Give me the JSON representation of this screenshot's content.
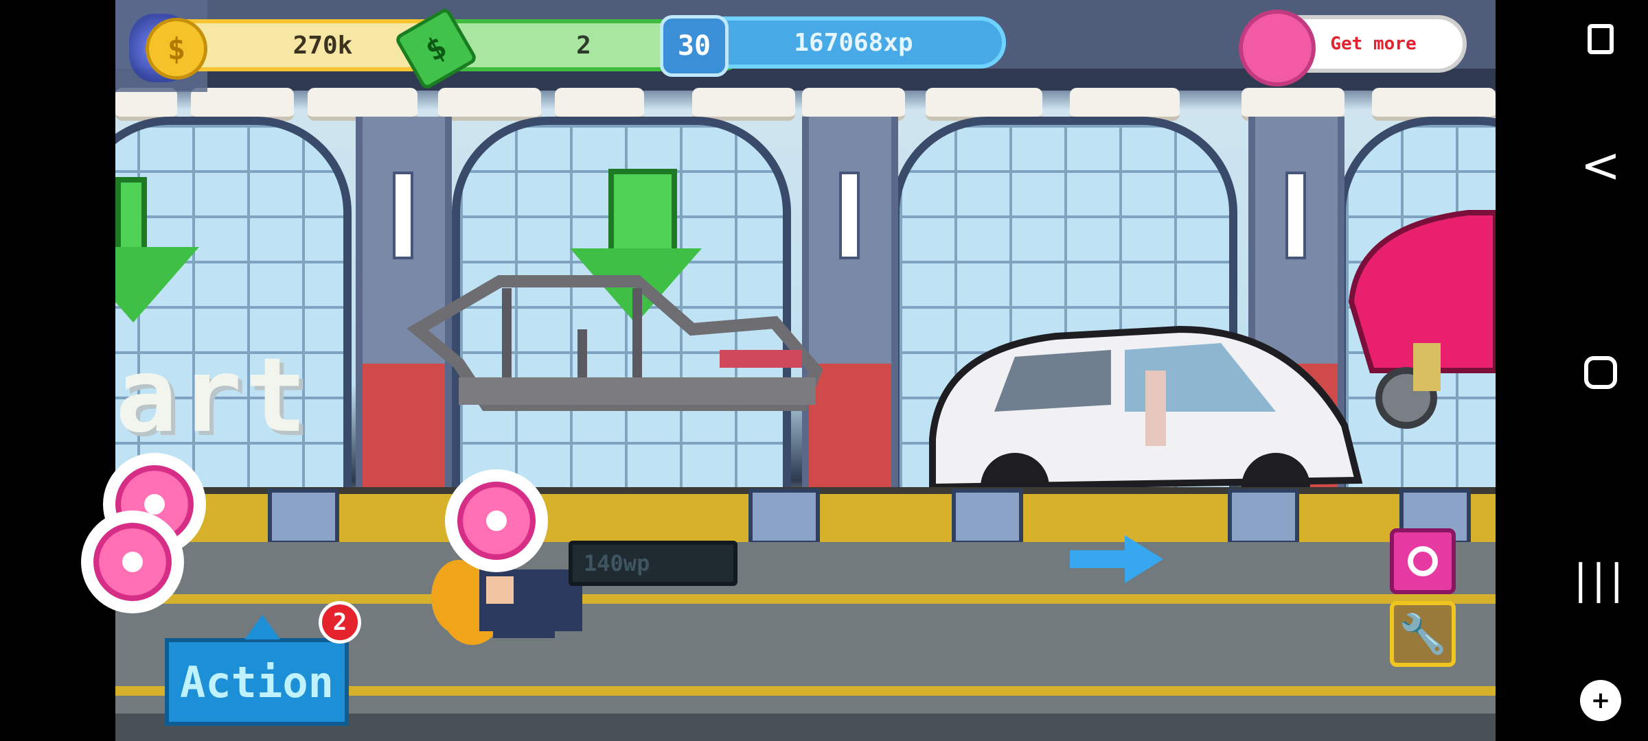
{
  "hud": {
    "coins": {
      "value": "270k",
      "icon": "coin-icon",
      "plus": "+"
    },
    "cash": {
      "value": "2",
      "icon": "cash-icon",
      "plus": "+"
    },
    "xp": {
      "level": "30",
      "value": "167068xp",
      "icon": "xp-badge-icon"
    },
    "get_more": {
      "label": "Get more",
      "icon": "donut-icon"
    }
  },
  "scene": {
    "start_text": "art",
    "worker_label": "140wp"
  },
  "controls": {
    "action_label": "Action",
    "action_badge": "2",
    "wrench_icon": "wrench-icon",
    "donut_button_icon": "donut-ring-icon"
  },
  "navbar": {
    "screenshot_icon": "screenshot-icon",
    "back_icon": "back-icon",
    "back_glyph": "<",
    "home_icon": "home-icon",
    "recents_icon": "recents-icon",
    "recents_glyph": "|||",
    "gamepad_icon": "gamepad-icon"
  },
  "colors": {
    "coin_accent": "#f7c531",
    "cash_accent": "#3fbc3f",
    "xp_accent": "#47a9e6",
    "action_blue": "#1c8fd6",
    "donut_pink": "#f35aa6"
  }
}
